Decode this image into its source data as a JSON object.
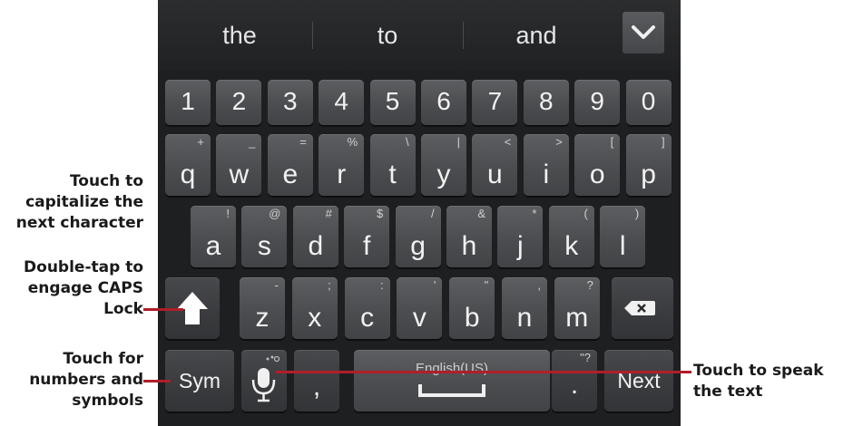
{
  "suggestions": [
    "the",
    "to",
    "and"
  ],
  "number_row": [
    "1",
    "2",
    "3",
    "4",
    "5",
    "6",
    "7",
    "8",
    "9",
    "0"
  ],
  "row1": [
    {
      "main": "q",
      "alt": "+"
    },
    {
      "main": "w",
      "alt": "_"
    },
    {
      "main": "e",
      "alt": "="
    },
    {
      "main": "r",
      "alt": "%"
    },
    {
      "main": "t",
      "alt": "\\"
    },
    {
      "main": "y",
      "alt": "|"
    },
    {
      "main": "u",
      "alt": "<"
    },
    {
      "main": "i",
      "alt": ">"
    },
    {
      "main": "o",
      "alt": "["
    },
    {
      "main": "p",
      "alt": "]"
    }
  ],
  "row2": [
    {
      "main": "a",
      "alt": "!"
    },
    {
      "main": "s",
      "alt": "@"
    },
    {
      "main": "d",
      "alt": "#"
    },
    {
      "main": "f",
      "alt": "$"
    },
    {
      "main": "g",
      "alt": "/"
    },
    {
      "main": "h",
      "alt": "&"
    },
    {
      "main": "j",
      "alt": "*"
    },
    {
      "main": "k",
      "alt": "("
    },
    {
      "main": "l",
      "alt": ")"
    }
  ],
  "row3": [
    {
      "main": "z",
      "alt": "-"
    },
    {
      "main": "x",
      "alt": ";"
    },
    {
      "main": "c",
      "alt": ":"
    },
    {
      "main": "v",
      "alt": "'"
    },
    {
      "main": "b",
      "alt": "\""
    },
    {
      "main": "n",
      "alt": ","
    },
    {
      "main": "m",
      "alt": "?"
    }
  ],
  "bottom": {
    "sym_label": "Sym",
    "comma": ",",
    "space_label": "English(US)",
    "period": ".",
    "period_alt": "\"?",
    "next_label": "Next"
  },
  "icons": {
    "shift": "shift-arrow-icon",
    "backspace": "backspace-icon",
    "mic": "microphone-icon",
    "collapse": "chevron-down-icon",
    "space": "spacebar-icon"
  },
  "callouts": {
    "shift_tap": [
      "Touch to",
      "capitalize the",
      "next character"
    ],
    "shift_double": [
      "Double-tap to",
      "engage CAPS",
      "Lock"
    ],
    "sym": [
      "Touch for",
      "numbers and",
      "symbols"
    ],
    "voice": [
      "Touch to speak",
      "the text"
    ]
  },
  "colors": {
    "keyboard_bg": "#1e1f21",
    "key": "#4c4d50",
    "leader": "#b01e2a"
  }
}
